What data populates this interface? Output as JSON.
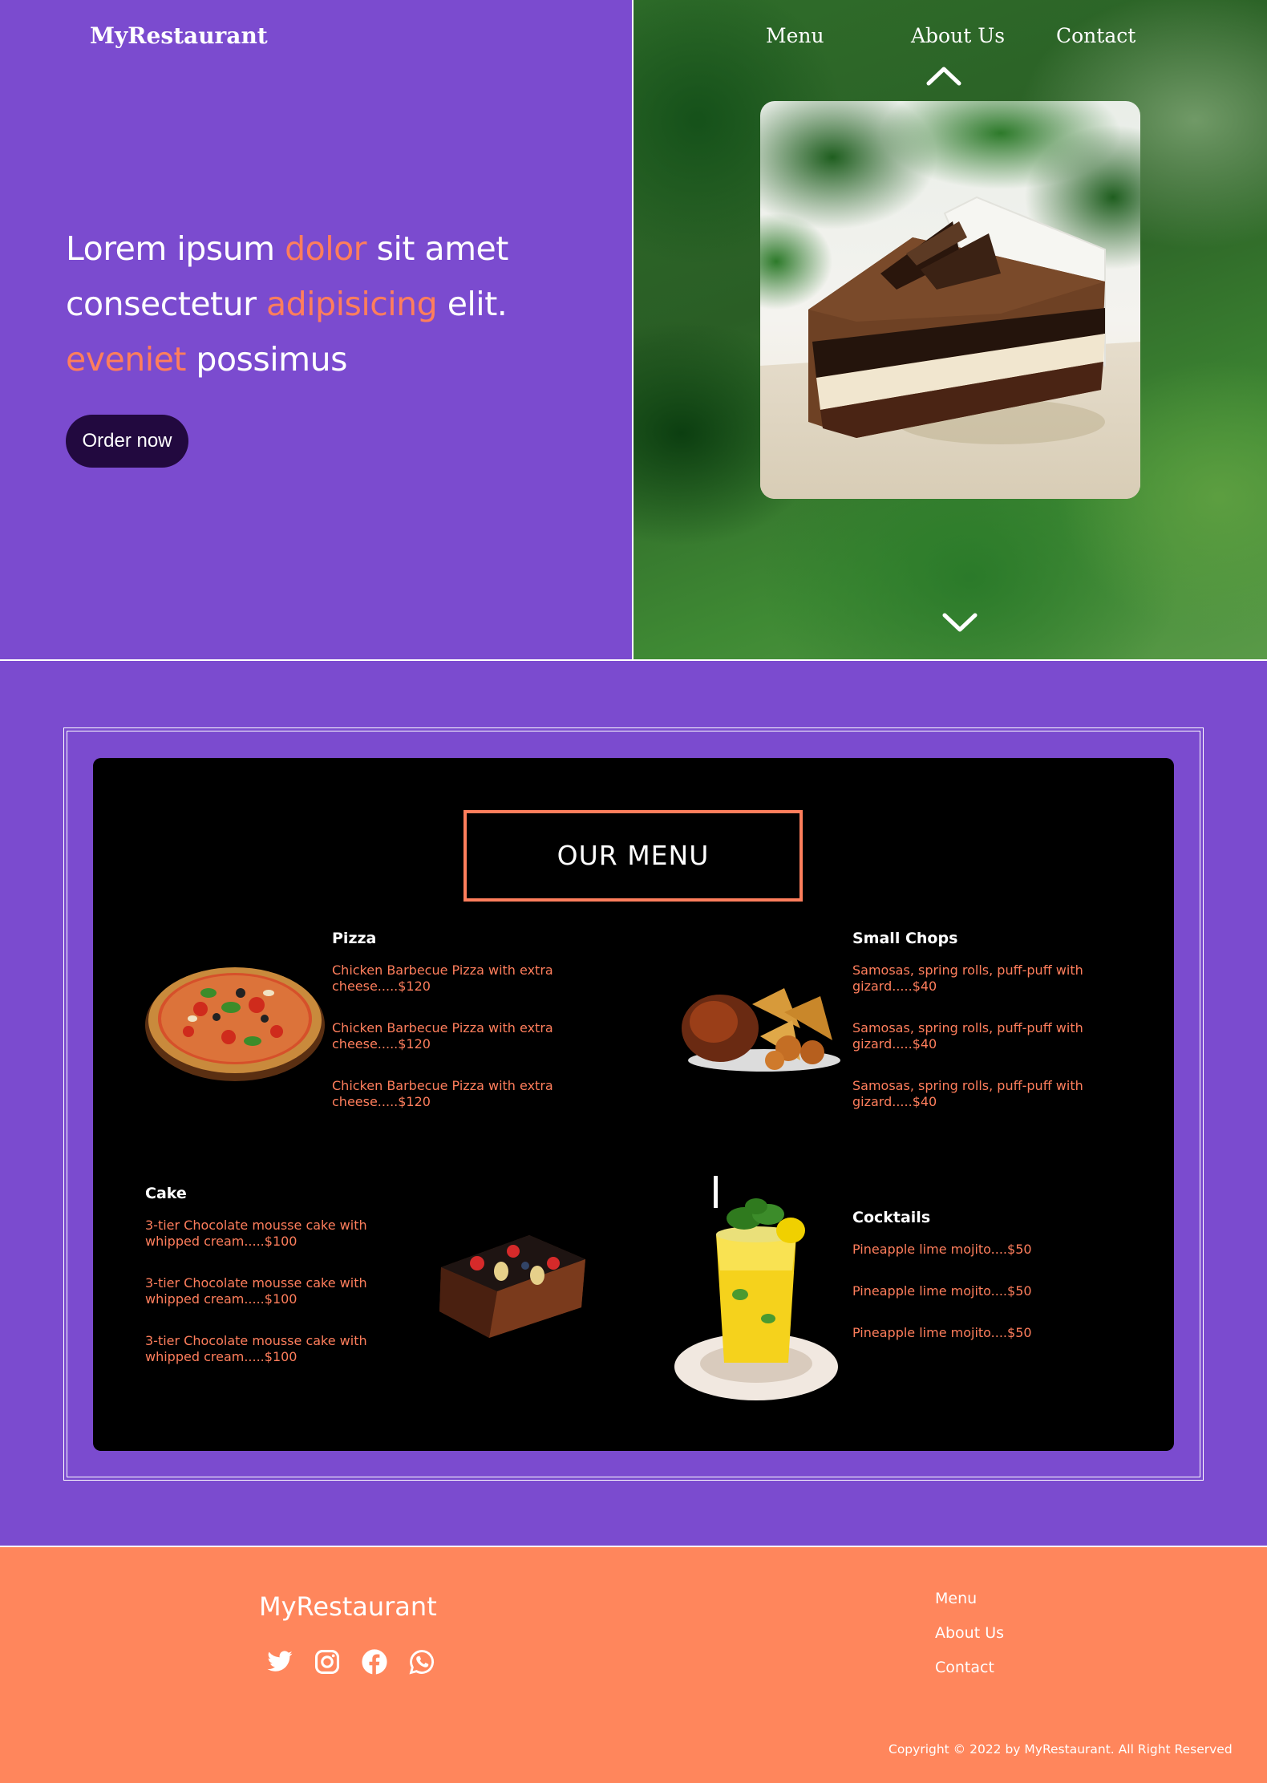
{
  "header": {
    "brand": "MyRestaurant",
    "nav": {
      "menu": "Menu",
      "about": "About Us",
      "contact": "Contact"
    }
  },
  "hero": {
    "line1_a": "Lorem ipsum ",
    "line1_hl": "dolor",
    "line1_b": " sit amet",
    "line2_a": "consectetur ",
    "line2_hl": "adipisicing",
    "line2_b": " elit.",
    "line3_hl": "eveniet",
    "line3_b": " possimus",
    "order_button": "Order now",
    "carousel_prev_icon": "chevron-up-icon",
    "carousel_next_icon": "chevron-down-icon"
  },
  "menu": {
    "title": "OUR MENU",
    "categories": [
      {
        "name": "Pizza",
        "image": "pizza-image",
        "items": [
          "Chicken Barbecue Pizza with extra cheese.....$120",
          "Chicken Barbecue Pizza with extra cheese.....$120",
          "Chicken Barbecue Pizza with extra cheese.....$120"
        ]
      },
      {
        "name": "Small Chops",
        "image": "small-chops-image",
        "items": [
          "Samosas, spring rolls, puff-puff with gizard.....$40",
          "Samosas, spring rolls, puff-puff with gizard.....$40",
          "Samosas, spring rolls, puff-puff with gizard.....$40"
        ]
      },
      {
        "name": "Cake",
        "image": "cake-image",
        "items": [
          "3-tier Chocolate mousse cake with whipped cream.....$100",
          "3-tier Chocolate mousse cake with whipped cream.....$100",
          "3-tier Chocolate mousse cake with whipped cream.....$100"
        ]
      },
      {
        "name": "Cocktails",
        "image": "cocktail-image",
        "items": [
          "Pineapple lime mojito....$50",
          "Pineapple lime mojito....$50",
          "Pineapple lime mojito....$50"
        ]
      }
    ]
  },
  "footer": {
    "brand": "MyRestaurant",
    "social_icons": [
      "twitter-icon",
      "instagram-icon",
      "facebook-icon",
      "whatsapp-icon"
    ],
    "links": {
      "menu": "Menu",
      "about": "About Us",
      "contact": "Contact"
    },
    "copyright": "Copyright © 2022 by MyRestaurant. All Right Reserved"
  },
  "colors": {
    "purple": "#7b4bcf",
    "accent": "#ff7e5c",
    "button_dark": "#22093f",
    "footer_orange": "#ff865c",
    "board": "#000000"
  }
}
